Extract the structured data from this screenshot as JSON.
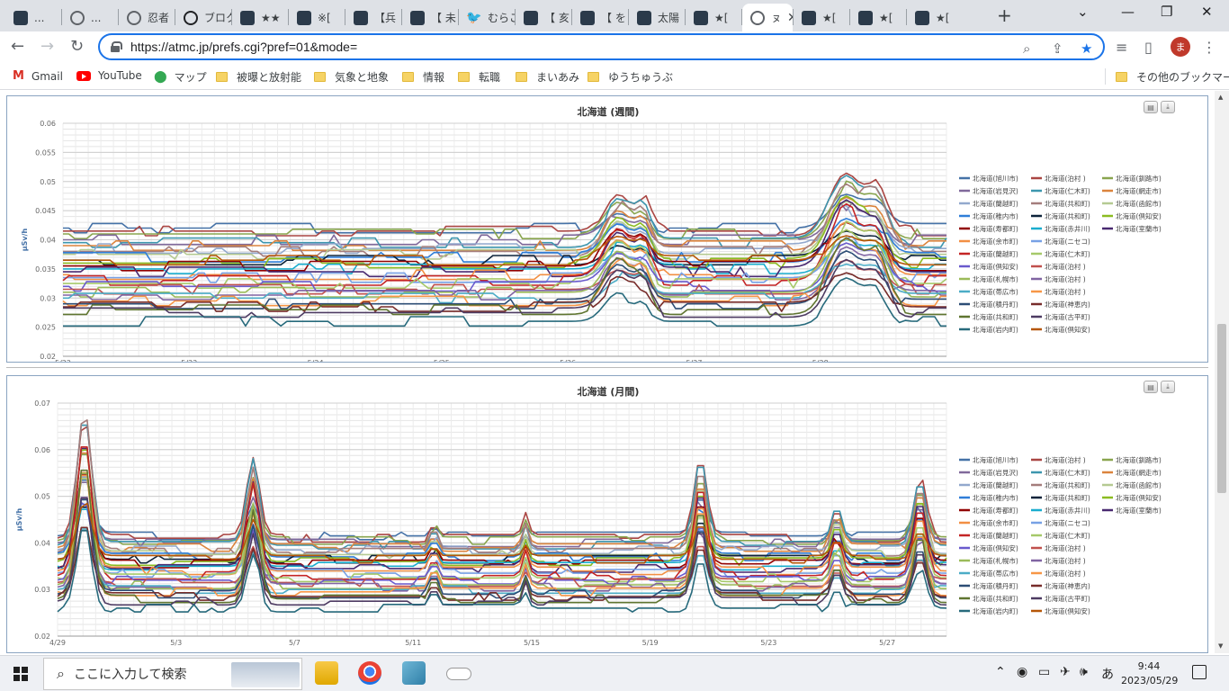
{
  "browser": {
    "tabs": [
      {
        "label": "...",
        "icon": "site-icon",
        "active": false
      },
      {
        "label": "...",
        "icon": "globe-icon",
        "active": false
      },
      {
        "label": "忍者",
        "icon": "globe-icon",
        "active": false
      },
      {
        "label": "ブロク",
        "icon": "dsp-icon",
        "active": false
      },
      {
        "label": "★★",
        "icon": "site-icon",
        "active": false
      },
      {
        "label": "※[",
        "icon": "site-icon",
        "active": false
      },
      {
        "label": "【兵",
        "icon": "site-icon",
        "active": false
      },
      {
        "label": "【 未",
        "icon": "site-icon",
        "active": false
      },
      {
        "label": "むらこ",
        "icon": "twitter-icon",
        "active": false
      },
      {
        "label": "【 亥",
        "icon": "site-icon",
        "active": false
      },
      {
        "label": "【 を",
        "icon": "site-icon",
        "active": false
      },
      {
        "label": "太陽",
        "icon": "site-icon",
        "active": false
      },
      {
        "label": "★[",
        "icon": "site-icon",
        "active": false
      },
      {
        "label": "ㇴ",
        "icon": "globe-icon",
        "active": true
      },
      {
        "label": "★[",
        "icon": "site-icon",
        "active": false
      },
      {
        "label": "★[",
        "icon": "site-icon",
        "active": false
      },
      {
        "label": "★[",
        "icon": "site-icon",
        "active": false
      }
    ],
    "url": "https://atmc.jp/prefs.cgi?pref=01&mode=",
    "profile_initial": "ま",
    "bookmarks": [
      {
        "label": "Gmail",
        "icon": "gmail-icon"
      },
      {
        "label": "YouTube",
        "icon": "youtube-icon"
      },
      {
        "label": "マップ",
        "icon": "maps-icon"
      },
      {
        "label": "被曝と放射能",
        "icon": "folder-icon"
      },
      {
        "label": "気象と地象",
        "icon": "folder-icon"
      },
      {
        "label": "情報",
        "icon": "folder-icon"
      },
      {
        "label": "転職",
        "icon": "folder-icon"
      },
      {
        "label": "まいあみ",
        "icon": "folder-icon"
      },
      {
        "label": "ゆうちゅうぶ",
        "icon": "folder-icon"
      }
    ],
    "other_bookmarks": "その他のブックマーク"
  },
  "legend_entries": [
    "北海道(旭川市)",
    "北海道(泊村 )",
    "北海道(釧路市)",
    "北海道(岩見沢)",
    "北海道(仁木町)",
    "北海道(網走市)",
    "北海道(蘭越町)",
    "北海道(共和町)",
    "北海道(函館市)",
    "北海道(稚内市)",
    "北海道(共和町)",
    "北海道(倶知安)",
    "北海道(寿都町)",
    "北海道(赤井川)",
    "北海道(室蘭市)",
    "北海道(余市町)",
    "北海道(ニセコ)",
    "北海道(蘭越町)",
    "北海道(仁木町)",
    "北海道(倶知安)",
    "北海道(泊村 )",
    "北海道(札幌市)",
    "北海道(泊村 )",
    "北海道(帯広市)",
    "北海道(泊村 )",
    "北海道(積丹町)",
    "北海道(神恵内)",
    "北海道(共和町)",
    "北海道(古平町)",
    "北海道(岩内町)",
    "北海道(倶知安)"
  ],
  "series_colors": [
    "#4572a7",
    "#aa4643",
    "#89a54e",
    "#80699b",
    "#3d96ae",
    "#db843d",
    "#92a8cd",
    "#a47d7c",
    "#b5ca92",
    "#2f7ed8",
    "#0d233a",
    "#8bbc21",
    "#910000",
    "#1aadce",
    "#492970",
    "#f28f43",
    "#77a1e5",
    "#c42525",
    "#a6c96a",
    "#6a5acd",
    "#c0504d",
    "#9bbb59",
    "#8064a2",
    "#4bacc6",
    "#f79646",
    "#2c4d75",
    "#772c2a",
    "#5f7530",
    "#4d3b62",
    "#276a7c",
    "#b65708"
  ],
  "chart_data": [
    {
      "type": "line",
      "title": "北海道 (週間)",
      "ylabel": "μSv/h",
      "ylim": [
        0.02,
        0.06
      ],
      "yticks": [
        "0.06",
        "0.055",
        "0.05",
        "0.045",
        "0.04",
        "0.035",
        "0.03",
        "0.025",
        "0.02"
      ],
      "xticks": [
        "5/22",
        "5/23",
        "5/24",
        "5/25",
        "5/26",
        "5/27",
        "5/28"
      ],
      "x_range": [
        0,
        7
      ],
      "baselines": [
        0.042,
        0.0415,
        0.041,
        0.04,
        0.0395,
        0.039,
        0.0385,
        0.038,
        0.0375,
        0.037,
        0.0365,
        0.036,
        0.0355,
        0.035,
        0.0345,
        0.034,
        0.0335,
        0.033,
        0.0325,
        0.032,
        0.0315,
        0.031,
        0.0305,
        0.03,
        0.0295,
        0.029,
        0.0285,
        0.028,
        0.0275,
        0.026,
        0.0365
      ],
      "events": [
        {
          "x": 4.4,
          "width": 0.15,
          "amp": 0.006
        },
        {
          "x": 4.6,
          "width": 0.08,
          "amp": 0.004
        },
        {
          "x": 6.2,
          "width": 0.18,
          "amp": 0.009
        },
        {
          "x": 6.45,
          "width": 0.12,
          "amp": 0.006
        }
      ]
    },
    {
      "type": "line",
      "title": "北海道 (月間)",
      "ylabel": "μSv/h",
      "ylim": [
        0.02,
        0.07
      ],
      "yticks": [
        "0.07",
        "0.06",
        "0.05",
        "0.04",
        "0.03",
        "0.02"
      ],
      "xticks": [
        "4/29",
        "5/3",
        "5/7",
        "5/11",
        "5/15",
        "5/19",
        "5/23",
        "5/27"
      ],
      "x_range": [
        0,
        30
      ],
      "baselines": [
        0.0415,
        0.041,
        0.0405,
        0.04,
        0.0395,
        0.039,
        0.0385,
        0.038,
        0.0375,
        0.037,
        0.0365,
        0.036,
        0.0355,
        0.035,
        0.0345,
        0.034,
        0.0335,
        0.033,
        0.0325,
        0.032,
        0.0315,
        0.031,
        0.0305,
        0.03,
        0.0295,
        0.029,
        0.0285,
        0.028,
        0.0275,
        0.026,
        0.0365
      ],
      "events": [
        {
          "x": 0.9,
          "width": 0.35,
          "amp": 0.022
        },
        {
          "x": 6.6,
          "width": 0.3,
          "amp": 0.014
        },
        {
          "x": 12.7,
          "width": 0.15,
          "amp": 0.004
        },
        {
          "x": 15.8,
          "width": 0.15,
          "amp": 0.004
        },
        {
          "x": 21.7,
          "width": 0.3,
          "amp": 0.014
        },
        {
          "x": 26.3,
          "width": 0.25,
          "amp": 0.006
        },
        {
          "x": 29.1,
          "width": 0.3,
          "amp": 0.011
        }
      ]
    }
  ],
  "taskbar": {
    "search_placeholder": "ここに入力して検索",
    "ime": "あ",
    "time": "9:44",
    "date": "2023/05/29"
  }
}
